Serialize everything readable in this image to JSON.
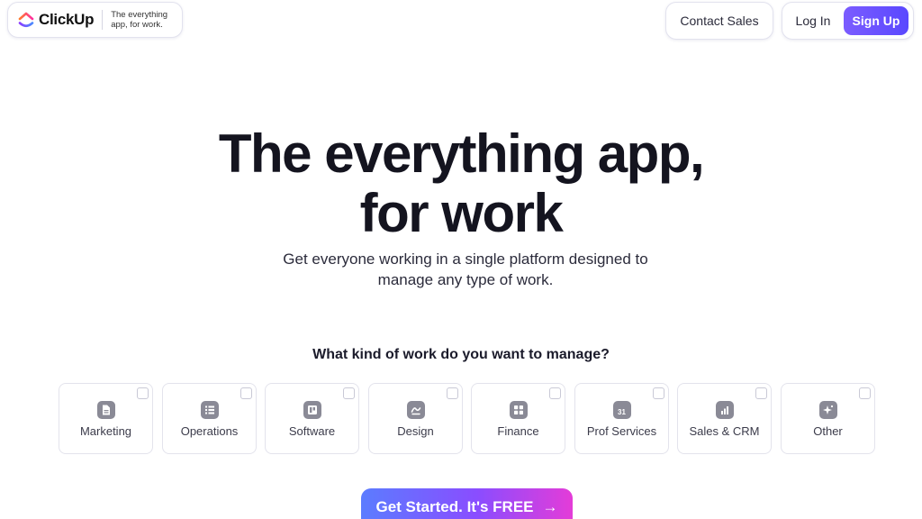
{
  "header": {
    "brand": "ClickUp",
    "tagline": "The everything app, for work.",
    "contact_label": "Contact Sales",
    "login_label": "Log In",
    "signup_label": "Sign Up"
  },
  "hero": {
    "title_line1": "The everything app,",
    "title_line2": "for work",
    "subtitle": "Get everyone working in a single platform designed to manage any type of work."
  },
  "question": "What kind of work do you want to manage?",
  "work_types": [
    {
      "label": "Marketing",
      "icon": "document-icon",
      "checked": false
    },
    {
      "label": "Operations",
      "icon": "list-icon",
      "checked": false
    },
    {
      "label": "Software",
      "icon": "board-icon",
      "checked": false
    },
    {
      "label": "Design",
      "icon": "pen-icon",
      "checked": false
    },
    {
      "label": "Finance",
      "icon": "grid-icon",
      "checked": false
    },
    {
      "label": "Prof Services",
      "icon": "calendar-icon",
      "checked": false,
      "icon_text": "31"
    },
    {
      "label": "Sales & CRM",
      "icon": "bar-chart-icon",
      "checked": false
    },
    {
      "label": "Other",
      "icon": "sparkle-icon",
      "checked": false
    }
  ],
  "cta": {
    "label": "Get Started. It's FREE",
    "arrow": "→"
  },
  "colors": {
    "brand_purple": "#7b5cff",
    "cta_start": "#5b7cff",
    "cta_end": "#e43cd8",
    "icon_gray": "#8a8a96"
  }
}
